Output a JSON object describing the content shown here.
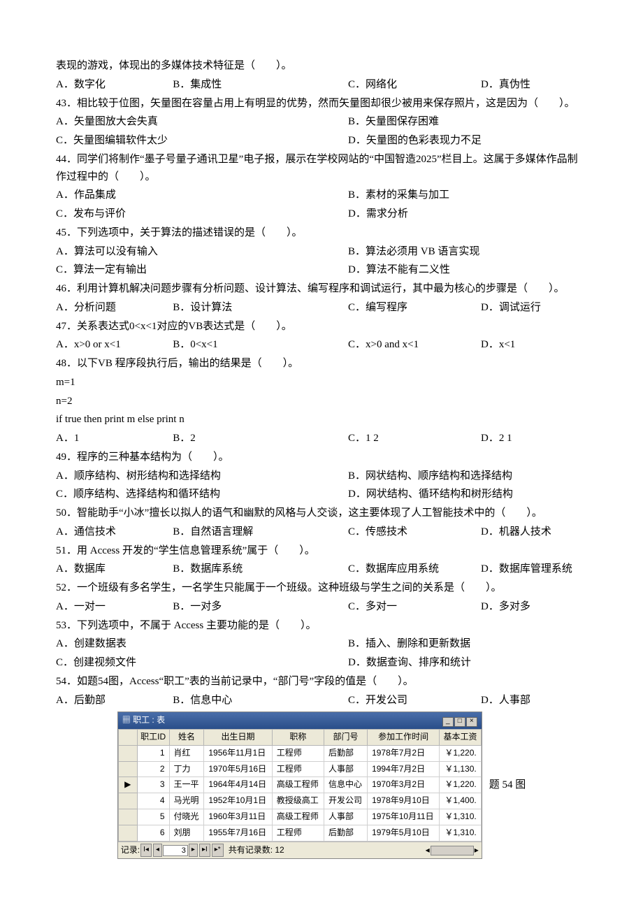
{
  "intro": "表现的游戏，体现出的多媒体技术特征是（　　）。",
  "q42opts": [
    "A．数字化",
    "B．集成性",
    "C．网络化",
    "D．真伪性"
  ],
  "q43": "43．相比较于位图，矢量图在容量占用上有明显的优势，然而矢量图却很少被用来保存照片，这是因为（　　）。",
  "q43opts": [
    "A．矢量图放大会失真",
    "B．矢量图保存困难",
    "C．矢量图编辑软件太少",
    "D．矢量图的色彩表现力不足"
  ],
  "q44": "44．同学们将制作“墨子号量子通讯卫星”电子报，展示在学校网站的“中国智造2025”栏目上。这属于多媒体作品制作过程中的（　　）。",
  "q44opts": [
    "A．作品集成",
    "B．素材的采集与加工",
    "C．发布与评价",
    "D．需求分析"
  ],
  "q45": "45．下列选项中，关于算法的描述错误的是（　　）。",
  "q45opts": [
    "A．算法可以没有输入",
    "B．算法必须用 VB 语言实现",
    "C．算法一定有输出",
    "D．算法不能有二义性"
  ],
  "q46": "46．利用计算机解决问题步骤有分析问题、设计算法、编写程序和调试运行，其中最为核心的步骤是（　　）。",
  "q46opts": [
    "A．分析问题",
    "B．设计算法",
    "C．编写程序",
    "D．调试运行"
  ],
  "q47": "47．关系表达式0<x<1对应的VB表达式是（　　）。",
  "q47opts": [
    "A．x>0 or x<1",
    "B．0<x<1",
    "C．x>0 and x<1",
    "D．x<1"
  ],
  "q48": "48．以下VB 程序段执行后，输出的结果是（　　）。",
  "q48code": [
    "m=1",
    "n=2",
    "if true then print m else print n"
  ],
  "q48opts": [
    "A．1",
    "B．2",
    "C．1 2",
    "D．2 1"
  ],
  "q49": "49．程序的三种基本结构为（　　）。",
  "q49opts": [
    "A．顺序结构、树形结构和选择结构",
    "B．网状结构、顺序结构和选择结构",
    "C．顺序结构、选择结构和循环结构",
    "D．网状结构、循环结构和树形结构"
  ],
  "q50": "50．智能助手“小冰”擅长以拟人的语气和幽默的风格与人交谈，这主要体现了人工智能技术中的（　　）。",
  "q50opts": [
    "A．通信技术",
    "B．自然语言理解",
    "C．传感技术",
    "D．机器人技术"
  ],
  "q51": "51．用 Access 开发的“学生信息管理系统”属于（　　）。",
  "q51opts": [
    "A．数据库",
    "B．数据库系统",
    "C．数据库应用系统",
    "D．数据库管理系统"
  ],
  "q52": "52．一个班级有多名学生，一名学生只能属于一个班级。这种班级与学生之间的关系是（　　）。",
  "q52opts": [
    "A．一对一",
    "B．一对多",
    "C．多对一",
    "D．多对多"
  ],
  "q53": "53．下列选项中，不属于 Access 主要功能的是（　　）。",
  "q53opts": [
    "A．创建数据表",
    "B．插入、删除和更新数据",
    "C．创建视频文件",
    "D．数据查询、排序和统计"
  ],
  "q54": "54．如题54图，Access“职工”表的当前记录中，“部门号”字段的值是（　　）。",
  "q54opts": [
    "A．后勤部",
    "B．信息中心",
    "C．开发公司",
    "D．人事部"
  ],
  "table": {
    "title": "职工 : 表",
    "headers": [
      "",
      "职工ID",
      "姓名",
      "出生日期",
      "职称",
      "部门号",
      "参加工作时间",
      "基本工资"
    ],
    "rows": [
      {
        "sel": "",
        "id": "1",
        "name": "肖红",
        "dob": "1956年11月1日",
        "title": "工程师",
        "dept": "后勤部",
        "hire": "1978年7月2日",
        "sal": "￥1,220."
      },
      {
        "sel": "",
        "id": "2",
        "name": "丁力",
        "dob": "1970年5月16日",
        "title": "工程师",
        "dept": "人事部",
        "hire": "1994年7月2日",
        "sal": "￥1,130."
      },
      {
        "sel": "▶",
        "id": "3",
        "name": "王一平",
        "dob": "1964年4月14日",
        "title": "高级工程师",
        "dept": "信息中心",
        "hire": "1970年3月2日",
        "sal": "￥1,220."
      },
      {
        "sel": "",
        "id": "4",
        "name": "马光明",
        "dob": "1952年10月1日",
        "title": "教授级高工",
        "dept": "开发公司",
        "hire": "1978年9月10日",
        "sal": "￥1,400."
      },
      {
        "sel": "",
        "id": "5",
        "name": "付晓光",
        "dob": "1960年3月11日",
        "title": "高级工程师",
        "dept": "人事部",
        "hire": "1975年10月11日",
        "sal": "￥1,310."
      },
      {
        "sel": "",
        "id": "6",
        "name": "刘朋",
        "dob": "1955年7月16日",
        "title": "工程师",
        "dept": "后勤部",
        "hire": "1979年5月10日",
        "sal": "￥1,310."
      }
    ],
    "nav": {
      "label": "记录:",
      "pos": "3",
      "total": "共有记录数: 12"
    },
    "caption": "题 54 图"
  }
}
